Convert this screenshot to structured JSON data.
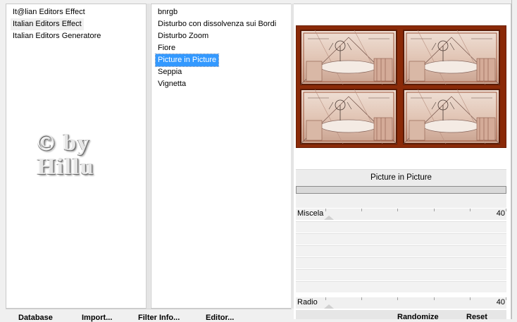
{
  "categories": {
    "items": [
      {
        "label": "It@lian Editors Effect",
        "state": "none"
      },
      {
        "label": "Italian Editors Effect",
        "state": "selected"
      },
      {
        "label": "Italian Editors Generatore",
        "state": "none"
      }
    ]
  },
  "watermark": {
    "line1": "© by",
    "line2": "Hillu"
  },
  "filters": {
    "items": [
      {
        "label": "bnrgb",
        "state": "none"
      },
      {
        "label": "Disturbo con dissolvenza sui Bordi",
        "state": "none"
      },
      {
        "label": "Disturbo Zoom",
        "state": "none"
      },
      {
        "label": "Fiore",
        "state": "none"
      },
      {
        "label": "Picture in Picture",
        "state": "active"
      },
      {
        "label": "Seppia",
        "state": "none"
      },
      {
        "label": "Vignetta",
        "state": "none"
      }
    ]
  },
  "preview": {
    "frame_color": "#8a2a08",
    "tile_bg": "#e8d2c4"
  },
  "filter_title": "Picture in Picture",
  "sliders": {
    "miscela": {
      "label": "Miscela",
      "value": "40"
    },
    "radio": {
      "label": "Radio",
      "value": "40"
    }
  },
  "bottom_buttons": {
    "database": "Database",
    "import": "Import...",
    "filter_info": "Filter Info...",
    "editor": "Editor...",
    "randomize": "Randomize",
    "reset": "Reset"
  },
  "colors": {
    "selection": "#3399ff",
    "window_bg": "#f0f0f0"
  }
}
